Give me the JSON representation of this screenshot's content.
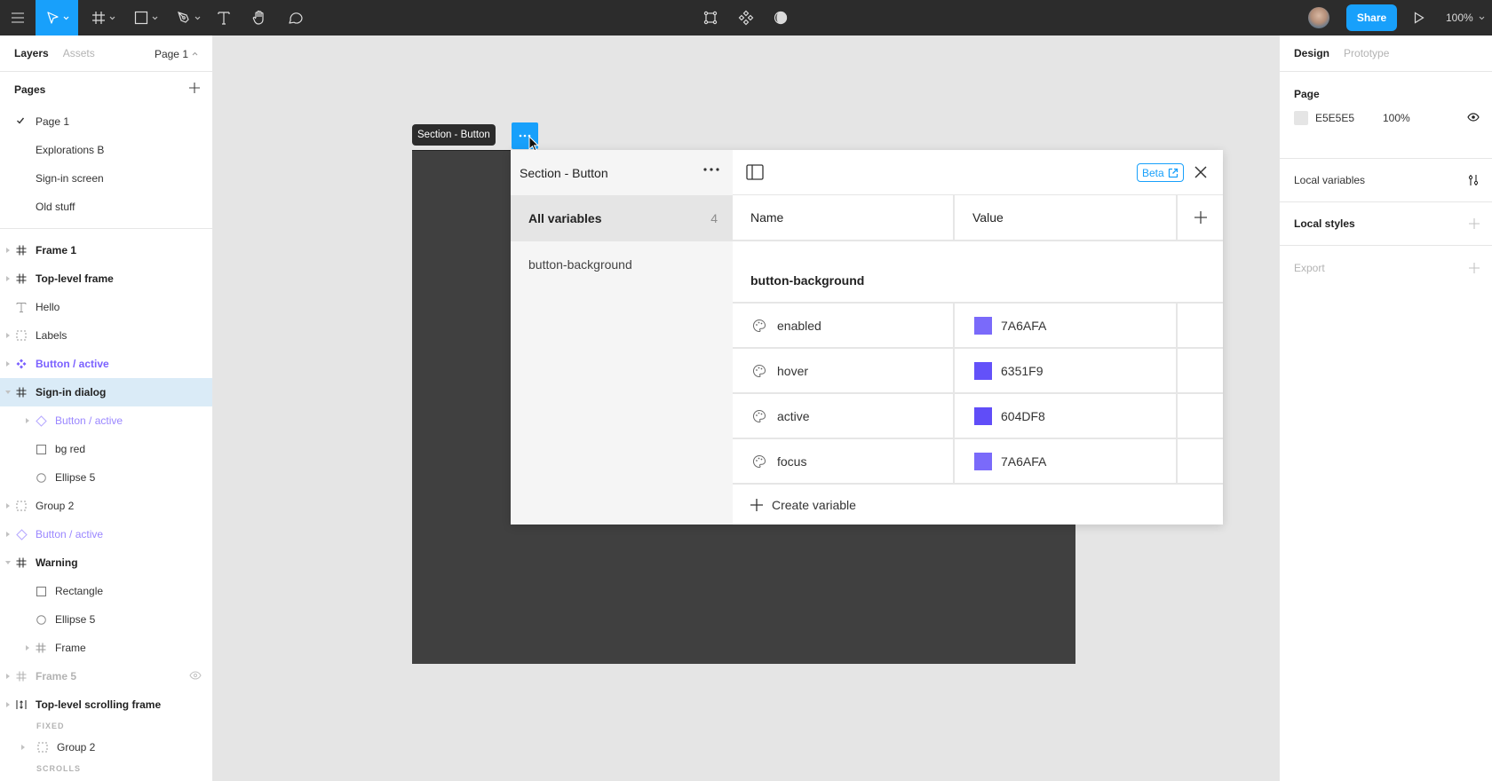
{
  "toolbar": {
    "tools": [
      {
        "name": "menu",
        "icon": "hamburger-icon"
      },
      {
        "name": "move",
        "icon": "move-cursor-icon",
        "active": true
      },
      {
        "name": "frame",
        "icon": "frame-icon"
      },
      {
        "name": "rectangle",
        "icon": "rectangle-icon"
      },
      {
        "name": "pen",
        "icon": "pen-icon"
      },
      {
        "name": "text",
        "icon": "text-icon"
      },
      {
        "name": "hand",
        "icon": "hand-icon"
      },
      {
        "name": "comment",
        "icon": "comment-icon"
      }
    ],
    "center_tools": [
      "mask-icon",
      "component-icon",
      "contrast-icon"
    ],
    "share_label": "Share",
    "zoom": "100%"
  },
  "left_panel": {
    "tabs": {
      "layers": "Layers",
      "assets": "Assets"
    },
    "current_page": "Page 1",
    "pages_title": "Pages",
    "pages": [
      {
        "label": "Page 1",
        "current": true
      },
      {
        "label": "Explorations B"
      },
      {
        "label": "Sign-in screen"
      },
      {
        "label": "Old stuff"
      }
    ],
    "layers": [
      {
        "label": "Frame 1",
        "icon": "frame",
        "indent": 0,
        "style": "bold",
        "expand": "collapsed"
      },
      {
        "label": "Top-level frame",
        "icon": "frame",
        "indent": 0,
        "style": "bold",
        "expand": "collapsed"
      },
      {
        "label": "Hello",
        "icon": "text",
        "indent": 0,
        "style": "normal",
        "expand": "none"
      },
      {
        "label": "Labels",
        "icon": "group",
        "indent": 0,
        "style": "normal",
        "expand": "collapsed"
      },
      {
        "label": "Button / active",
        "icon": "component",
        "indent": 0,
        "style": "purple-bold",
        "expand": "collapsed"
      },
      {
        "label": "Sign-in dialog",
        "icon": "frame",
        "indent": 0,
        "style": "bold",
        "expand": "expanded",
        "selected": true
      },
      {
        "label": "Button / active",
        "icon": "instance",
        "indent": 1,
        "style": "purple",
        "expand": "collapsed"
      },
      {
        "label": "bg red",
        "icon": "rectangle",
        "indent": 1,
        "style": "normal",
        "expand": "none"
      },
      {
        "label": "Ellipse 5",
        "icon": "ellipse",
        "indent": 1,
        "style": "normal",
        "expand": "none"
      },
      {
        "label": "Group 2",
        "icon": "group",
        "indent": 0,
        "style": "normal",
        "expand": "collapsed"
      },
      {
        "label": "Button / active",
        "icon": "instance",
        "indent": 0,
        "style": "purple",
        "expand": "collapsed"
      },
      {
        "label": "Warning",
        "icon": "frame",
        "indent": 0,
        "style": "bold",
        "expand": "expanded"
      },
      {
        "label": "Rectangle",
        "icon": "rectangle",
        "indent": 1,
        "style": "normal",
        "expand": "none"
      },
      {
        "label": "Ellipse 5",
        "icon": "ellipse",
        "indent": 1,
        "style": "normal",
        "expand": "none"
      },
      {
        "label": "Frame",
        "icon": "frame",
        "indent": 1,
        "style": "normal",
        "expand": "collapsed"
      },
      {
        "label": "Frame 5",
        "icon": "frame",
        "indent": 0,
        "style": "dim-bold",
        "expand": "collapsed",
        "hidden": true
      },
      {
        "label": "Top-level scrolling frame",
        "icon": "scroll-frame",
        "indent": 0,
        "style": "bold",
        "expand": "collapsed"
      }
    ],
    "fixed_label": "FIXED",
    "scroll_child": {
      "label": "Group 2",
      "icon": "group"
    },
    "scrolls_label": "SCROLLS"
  },
  "canvas": {
    "section_label": "Section - Button",
    "section_color": "#404040"
  },
  "variables_modal": {
    "collection_name": "Section - Button",
    "groups": [
      {
        "label": "All variables",
        "count": "4",
        "active": true
      },
      {
        "label": "button-background"
      }
    ],
    "beta_label": "Beta",
    "columns": {
      "name": "Name",
      "value": "Value"
    },
    "group_heading": "button-background",
    "rows": [
      {
        "name": "enabled",
        "value": "7A6AFA",
        "color": "#7A6AFA"
      },
      {
        "name": "hover",
        "value": "6351F9",
        "color": "#6351F9"
      },
      {
        "name": "active",
        "value": "604DF8",
        "color": "#604DF8"
      },
      {
        "name": "focus",
        "value": "7A6AFA",
        "color": "#7A6AFA"
      }
    ],
    "create_label": "Create variable"
  },
  "right_panel": {
    "tabs": {
      "design": "Design",
      "prototype": "Prototype"
    },
    "page_title": "Page",
    "page_fill": {
      "hex": "E5E5E5",
      "opacity": "100%",
      "color": "#E5E5E5"
    },
    "local_variables": "Local variables",
    "local_styles": "Local styles",
    "export": "Export"
  },
  "colors": {
    "accent": "#18A0FB",
    "toolbar_bg": "#2C2C2C",
    "component_purple": "#7B61FF",
    "selection_bg": "#DAEBF7"
  }
}
